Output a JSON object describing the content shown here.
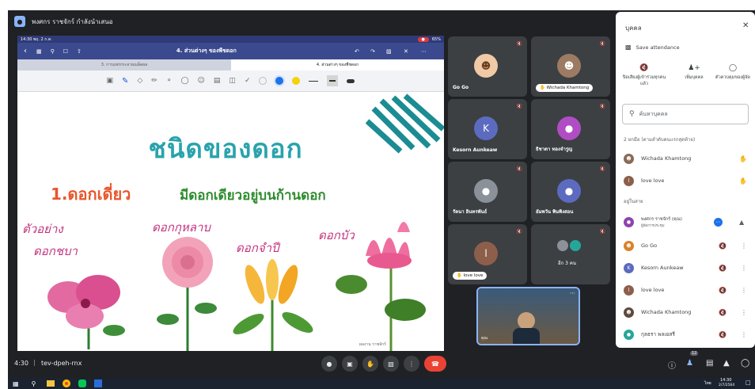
{
  "presenter_bar": {
    "label": "พงศกร ราชจักร์ กำลังนำเสนอ"
  },
  "ipad": {
    "status_time": "14:30",
    "status_date": "พฤ. 2 ก.ค.",
    "battery": "65%",
    "doc_title": "4. ส่วนต่างๆ ของพืชดอก",
    "tab_left": "3. การแพร่กระจายเมล็ดผล",
    "tab_right": "4. ส่วนต่างๆ ของพืชดอก"
  },
  "slide": {
    "title": "ชนิดของดอก",
    "subtitle_num": "1.ดอกเดี่ยว",
    "subtitle_desc": "มีดอกเดียวอยู่บนก้านดอก",
    "example_label": "ตัวอย่าง",
    "flower_1": "ดอกชบา",
    "flower_2": "ดอกกุหลาบ",
    "flower_3": "ดอกจำปี",
    "flower_4": "ดอกบัว",
    "watermark": "ผลงาน ราชจักร์"
  },
  "tiles": [
    {
      "name": "Go Go"
    },
    {
      "name": "Wichada Khamtong"
    },
    {
      "name": "Kesorn Aunkeaw",
      "initial": "K"
    },
    {
      "name": "ธิชาดา ทองจำรูญ"
    },
    {
      "name": "รัตนา อินทรพันธ์"
    },
    {
      "name": "อัมพวัน พินพิงสอน"
    },
    {
      "name": "love love",
      "initial": "l"
    },
    {
      "name": "อีก 3 คน"
    }
  ],
  "self_tile": {
    "label": "คุณ"
  },
  "bottom_bar": {
    "time": "4:30",
    "meeting_code": "tev-dpeh-rnx",
    "people_count": "12"
  },
  "taskbar": {
    "time": "14:30",
    "date": "2/7/2564",
    "lang": "ไทย"
  },
  "panel": {
    "title": "บุคคล",
    "save_attendance": "Save attendance",
    "action_mute": "ปิดเสียงผู้เข้าร่วมทุกคนแล้ว",
    "action_add": "เพิ่มบุคคล",
    "action_host": "ตัวควบคุมของผู้จัด",
    "search_placeholder": "ค้นหาบุคคล",
    "raised_header": "2 ยกมือ (ตามลำดับคนแรกสุดท้าย)",
    "raised": [
      "Wichada Khamtong",
      "love love"
    ],
    "in_call_header": "อยู่ในสาย",
    "host_name": "พงศกร ราชจักร์ (คุณ)",
    "host_role": "ผู้จัดการประชุม",
    "people": [
      "Go Go",
      "Kesorn Aunkeaw",
      "love love",
      "Wichada Khamtong",
      "กุลธรา พลเยสรี"
    ]
  }
}
